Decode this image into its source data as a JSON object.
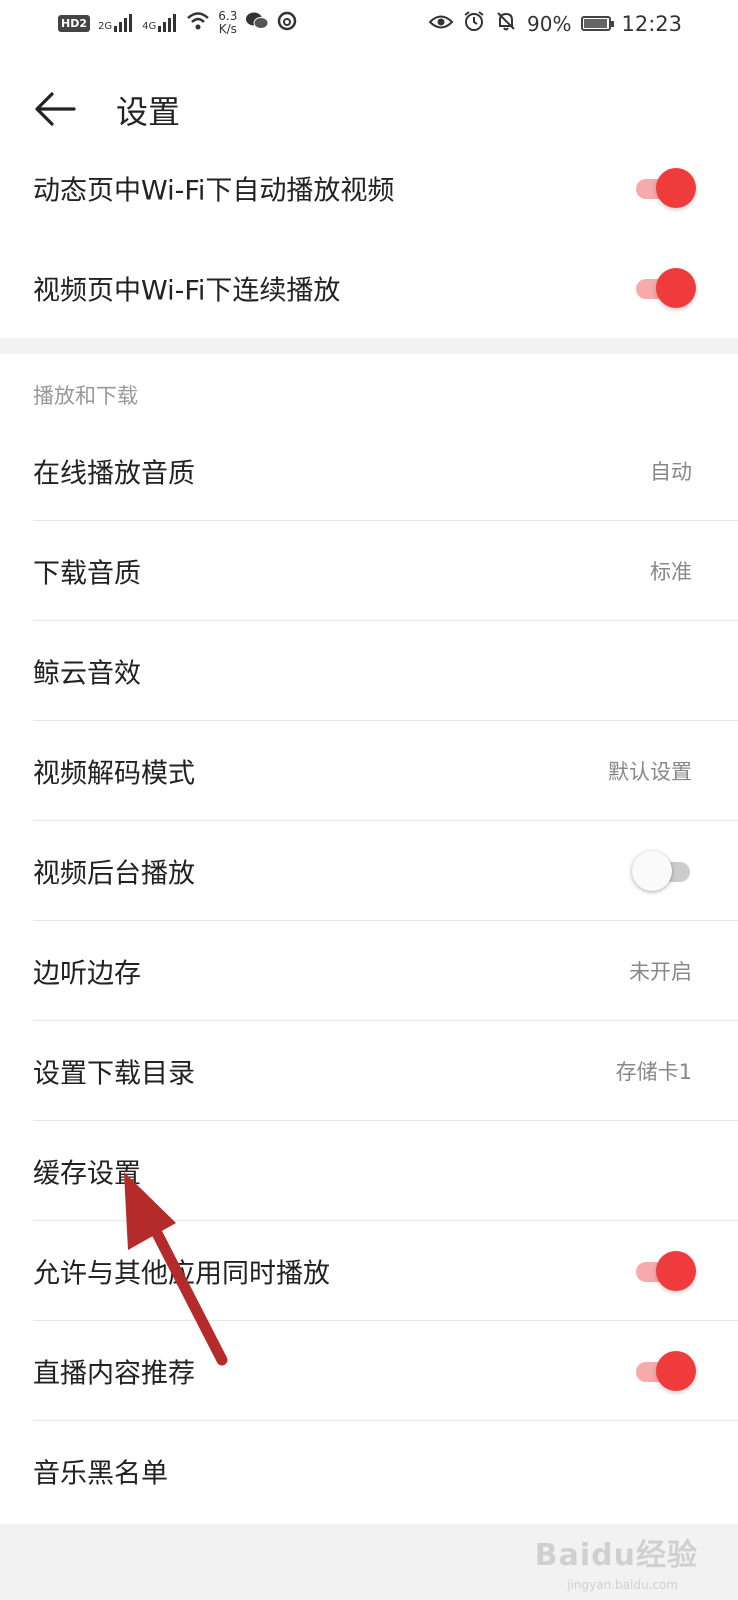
{
  "status_bar": {
    "hd_badge": "HD",
    "hd_sub": "2",
    "signal1_label": "2G",
    "signal2_label": "4G",
    "speed_value": "6.3",
    "speed_unit": "K/s",
    "battery_percent": "90%",
    "time": "12:23"
  },
  "header": {
    "title": "设置"
  },
  "rows_top": [
    {
      "label": "动态页中Wi-Fi下自动播放视频",
      "toggle": "on"
    },
    {
      "label": "视频页中Wi-Fi下连续播放",
      "toggle": "on"
    }
  ],
  "section": {
    "title": "播放和下载"
  },
  "rows": [
    {
      "label": "在线播放音质",
      "value": "自动"
    },
    {
      "label": "下载音质",
      "value": "标准"
    },
    {
      "label": "鲸云音效",
      "value": ""
    },
    {
      "label": "视频解码模式",
      "value": "默认设置"
    },
    {
      "label": "视频后台播放",
      "toggle": "off"
    },
    {
      "label": "边听边存",
      "value": "未开启"
    },
    {
      "label": "设置下载目录",
      "value": "存储卡1"
    },
    {
      "label": "缓存设置",
      "value": ""
    },
    {
      "label": "允许与其他应用同时播放",
      "toggle": "on"
    },
    {
      "label": "直播内容推荐",
      "toggle": "on"
    },
    {
      "label": "音乐黑名单",
      "value": ""
    }
  ],
  "watermark": {
    "text": "Baidu经验",
    "sub": "jingyan.baidu.com"
  },
  "colors": {
    "accent": "#ef3b3b",
    "annotation_arrow": "#b52a2a"
  }
}
